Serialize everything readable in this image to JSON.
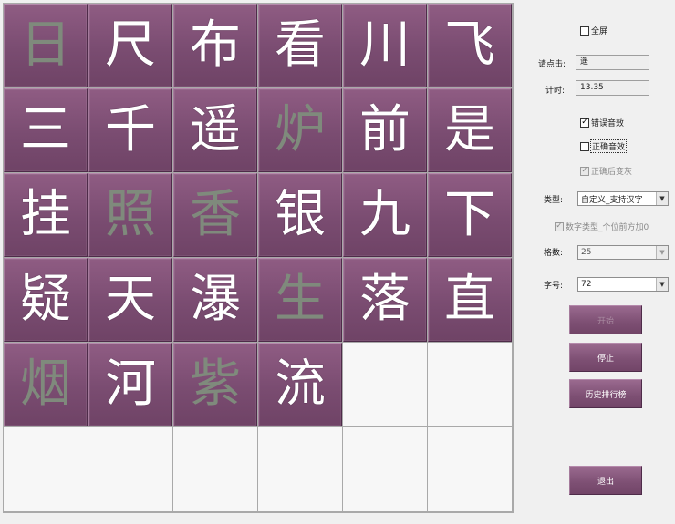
{
  "grid": {
    "cells": [
      {
        "char": "日",
        "dim": true
      },
      {
        "char": "尺",
        "dim": false
      },
      {
        "char": "布",
        "dim": false
      },
      {
        "char": "看",
        "dim": false
      },
      {
        "char": "川",
        "dim": false
      },
      {
        "char": "飞",
        "dim": false
      },
      {
        "char": "三",
        "dim": false
      },
      {
        "char": "千",
        "dim": false
      },
      {
        "char": "遥",
        "dim": false
      },
      {
        "char": "炉",
        "dim": true
      },
      {
        "char": "前",
        "dim": false
      },
      {
        "char": "是",
        "dim": false
      },
      {
        "char": "挂",
        "dim": false
      },
      {
        "char": "照",
        "dim": true
      },
      {
        "char": "香",
        "dim": true
      },
      {
        "char": "银",
        "dim": false
      },
      {
        "char": "九",
        "dim": false
      },
      {
        "char": "下",
        "dim": false
      },
      {
        "char": "疑",
        "dim": false
      },
      {
        "char": "天",
        "dim": false
      },
      {
        "char": "瀑",
        "dim": false
      },
      {
        "char": "生",
        "dim": true
      },
      {
        "char": "落",
        "dim": false
      },
      {
        "char": "直",
        "dim": false
      },
      {
        "char": "烟",
        "dim": true
      },
      {
        "char": "河",
        "dim": false
      },
      {
        "char": "紫",
        "dim": true
      },
      {
        "char": "流",
        "dim": false
      },
      {
        "char": "",
        "empty": true
      },
      {
        "char": "",
        "empty": true
      },
      {
        "char": "",
        "empty": true
      },
      {
        "char": "",
        "empty": true
      },
      {
        "char": "",
        "empty": true
      },
      {
        "char": "",
        "empty": true
      },
      {
        "char": "",
        "empty": true
      },
      {
        "char": "",
        "empty": true
      }
    ]
  },
  "panel": {
    "fullscreen": {
      "label": "全屏",
      "checked": false
    },
    "click_prompt": {
      "label": "请点击:",
      "value": "遥"
    },
    "timer": {
      "label": "计时:",
      "value": "13.35"
    },
    "error_sound": {
      "label": "错误音效",
      "checked": true
    },
    "correct_sound": {
      "label": "正确音效",
      "checked": false
    },
    "gray_after_correct": {
      "label": "正确后变灰",
      "checked": true
    },
    "type": {
      "label": "类型:",
      "value": "自定义_支持汉字"
    },
    "digit_pad": {
      "label": "数字类型_个位前方加0",
      "checked": true
    },
    "cell_count": {
      "label": "格数:",
      "value": "25"
    },
    "font_size": {
      "label": "字号:",
      "value": "72"
    },
    "start_button": "开始",
    "stop_button": "停止",
    "history_button": "历史排行榜",
    "exit_button": "退出"
  },
  "colors": {
    "tile": "#7d4f73",
    "tile_text": "#ffffff",
    "tile_text_dim": "#7f8a7c",
    "background": "#f0f0f0"
  }
}
